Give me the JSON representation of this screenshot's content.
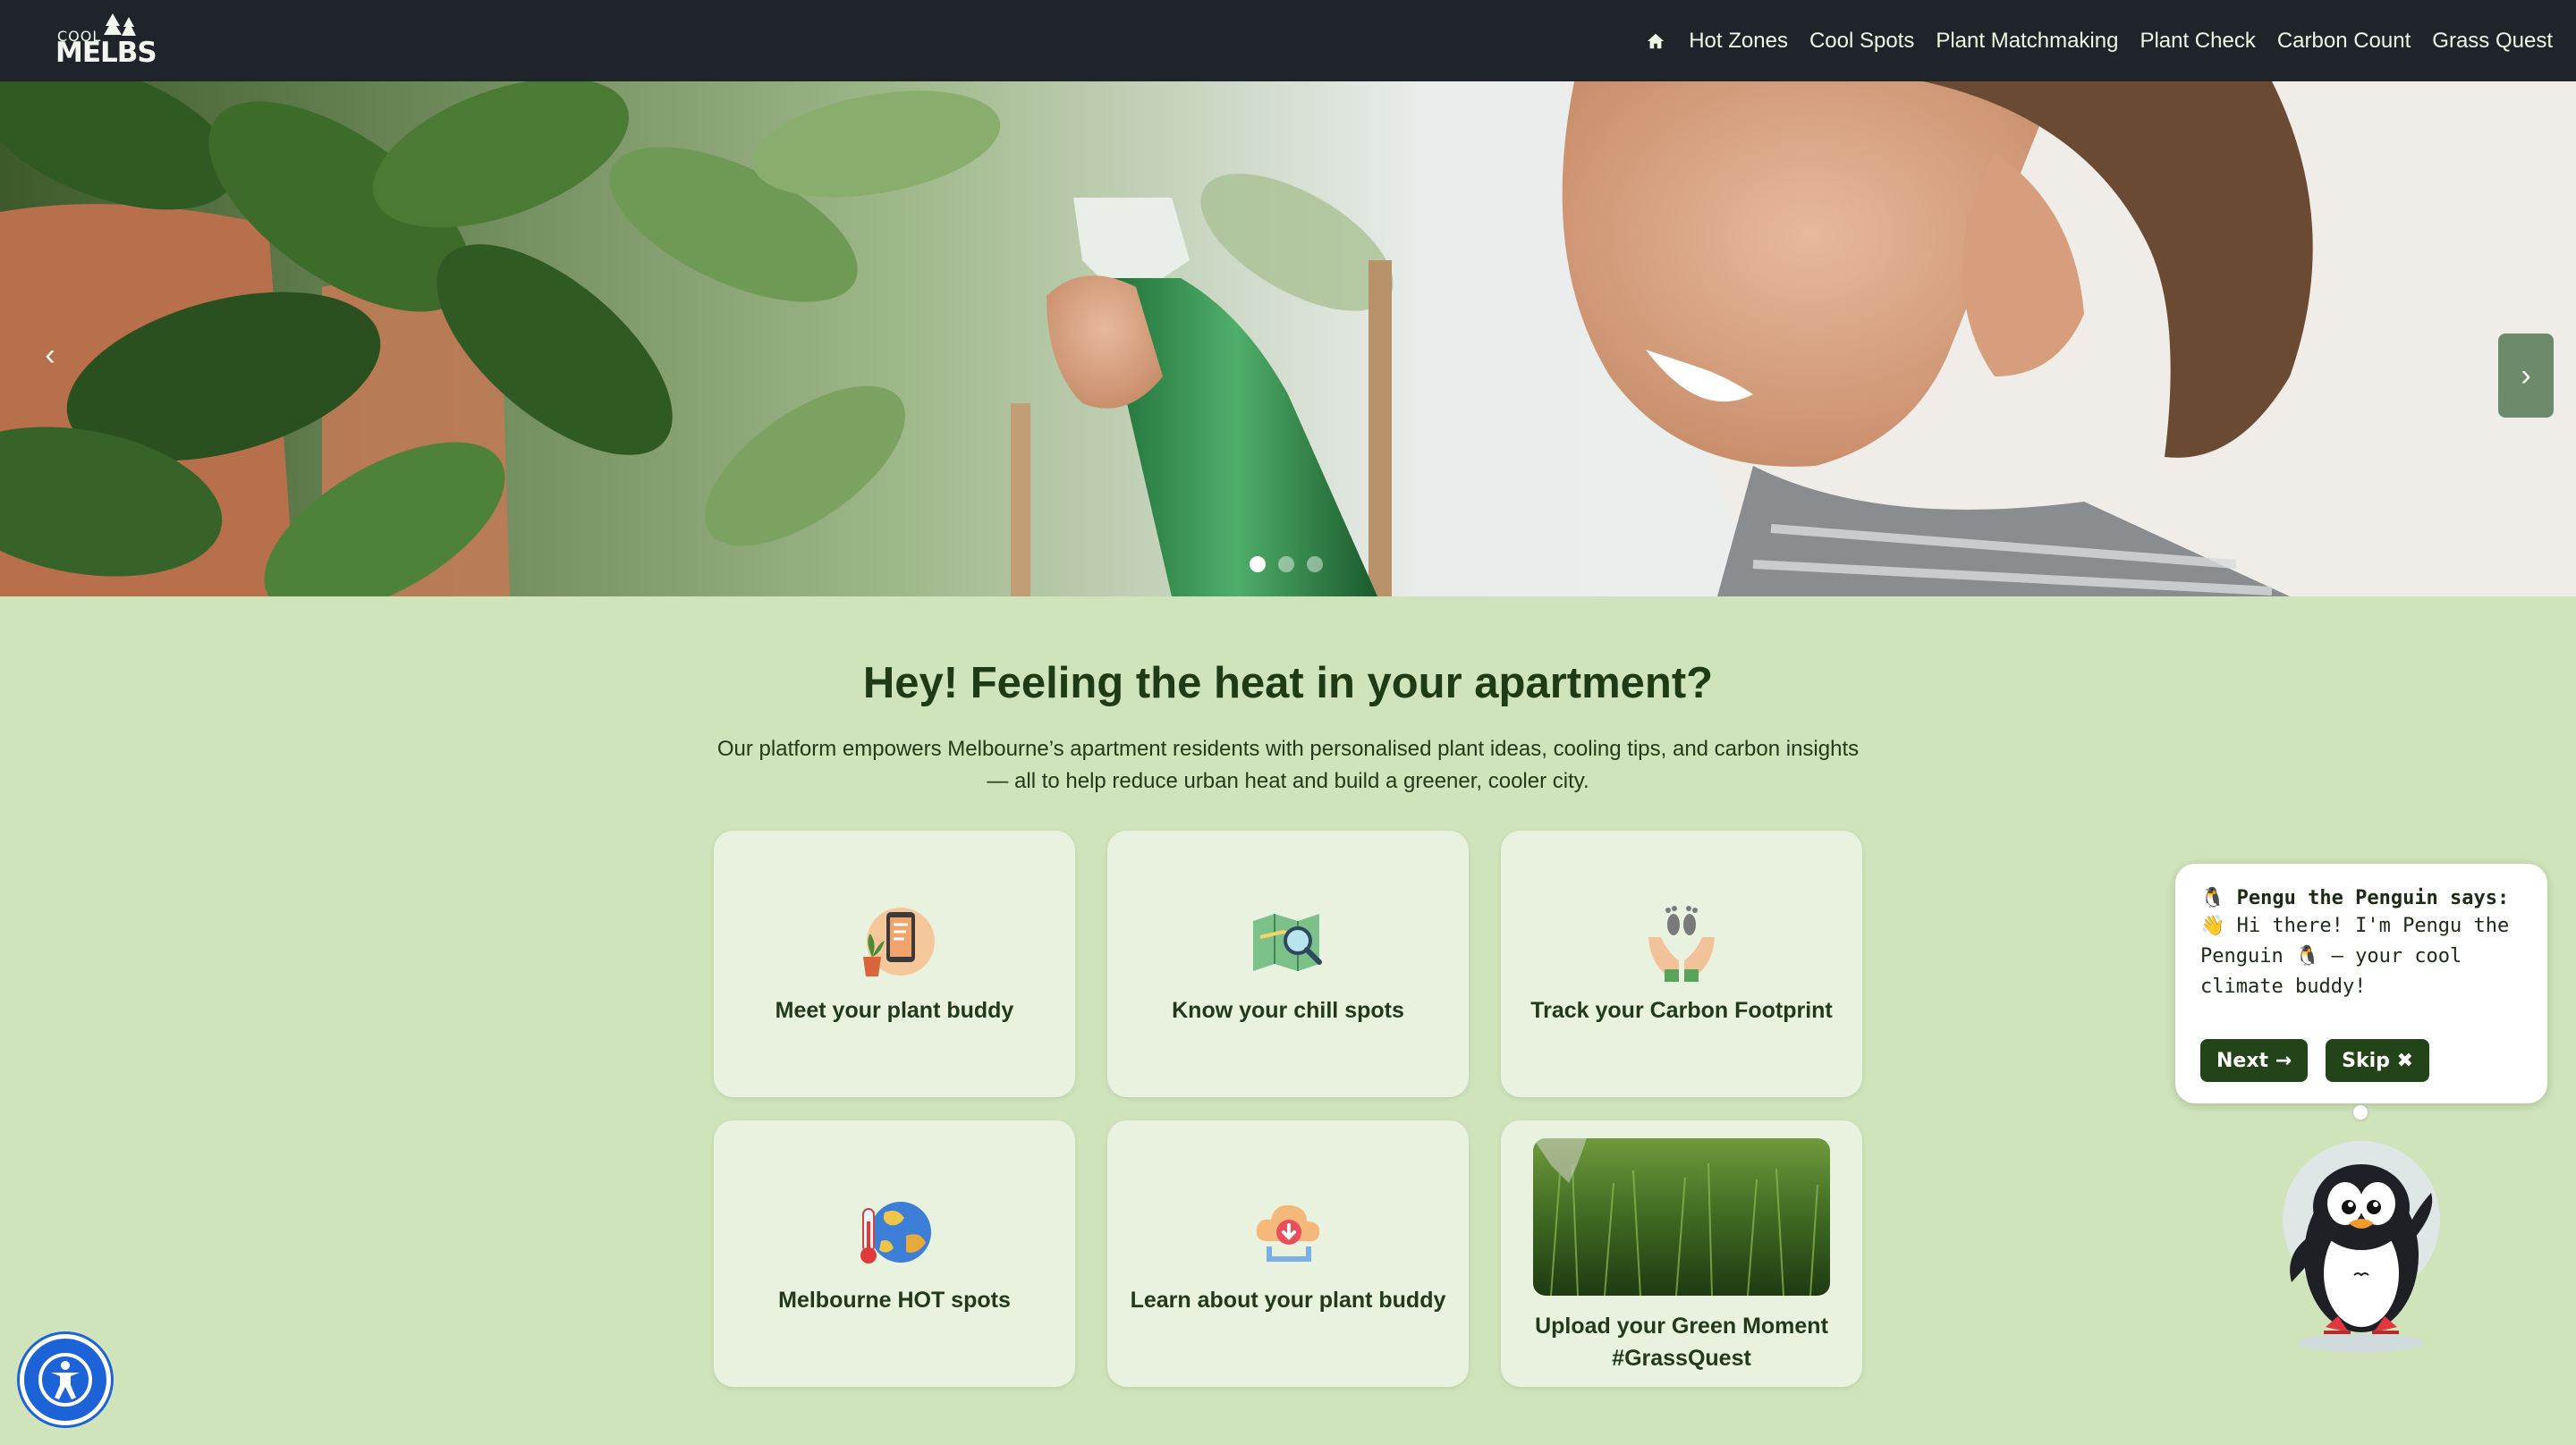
{
  "brand": {
    "logo_top": "COOL",
    "logo_main": "MELBS"
  },
  "nav": {
    "home_icon": "home-icon",
    "links": [
      "Hot Zones",
      "Cool Spots",
      "Plant Matchmaking",
      "Plant Check",
      "Carbon Count",
      "Grass Quest"
    ]
  },
  "hero": {
    "prev_glyph": "‹",
    "next_glyph": "›",
    "slide_count": 3,
    "active_slide": 1
  },
  "main": {
    "headline": "Hey! Feeling the heat in your apartment?",
    "intro": "Our platform empowers Melbourne’s apartment residents with personalised plant ideas, cooling tips, and carbon insights — all to help reduce urban heat and build a greener, cooler city.",
    "cards": [
      {
        "label": "Meet your plant buddy",
        "icon": "phone-plant-icon"
      },
      {
        "label": "Know your chill spots",
        "icon": "map-search-icon"
      },
      {
        "label": "Track your Carbon Footprint",
        "icon": "hands-footprint-icon"
      },
      {
        "label": "Melbourne HOT spots",
        "icon": "hot-globe-icon"
      },
      {
        "label": "Learn about your plant buddy",
        "icon": "cloud-download-icon"
      },
      {
        "label": "Upload your Green Moment #GrassQuest",
        "icon": "grass-photo"
      }
    ]
  },
  "pengu": {
    "title": "🐧 Pengu the Penguin says:",
    "message": "👋 Hi there! I'm Pengu the Penguin 🐧 — your cool climate buddy!",
    "next_label": "Next →",
    "skip_label": "Skip ✖"
  },
  "accessibility": {
    "icon": "accessibility-icon"
  },
  "colors": {
    "nav_bg": "#1f232a",
    "page_bg": "#cfe4bb",
    "card_bg": "#e9f2df",
    "heading": "#1f3b16",
    "button": "#234318",
    "a11y": "#1b63d6"
  }
}
